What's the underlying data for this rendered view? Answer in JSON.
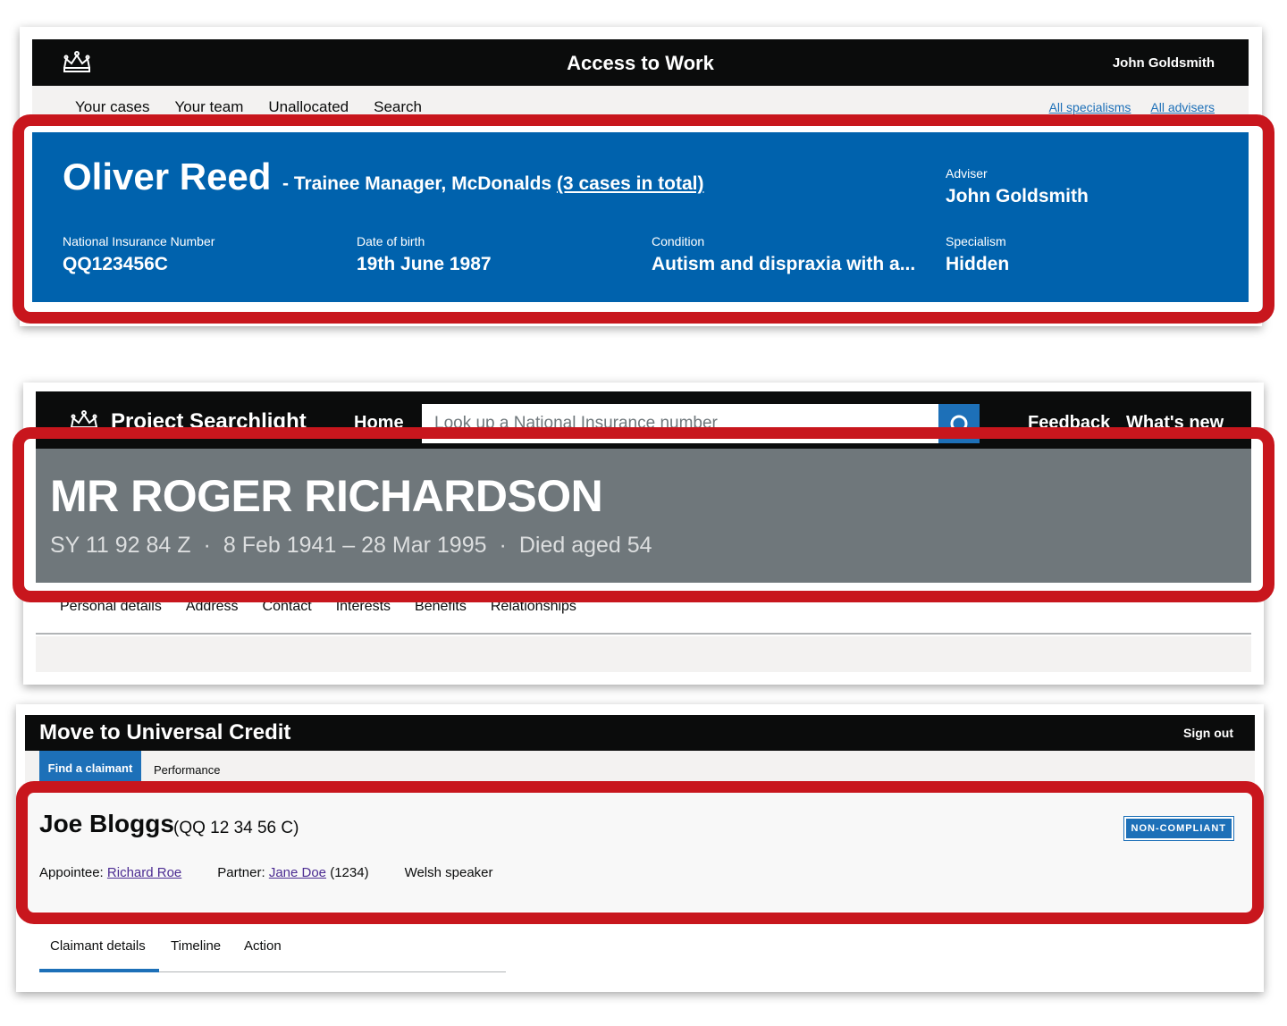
{
  "access_to_work": {
    "service_name": "Access to Work",
    "user_name": "John Goldsmith",
    "nav": [
      "Your cases",
      "Your team",
      "Unallocated",
      "Search"
    ],
    "filters": [
      "All specialisms",
      "All advisers"
    ],
    "person": {
      "name": "Oliver Reed",
      "role": "- Trainee Manager, McDonalds",
      "cases_link": "(3 cases in total)"
    },
    "fields": {
      "adviser_label": "Adviser",
      "adviser_value": "John Goldsmith",
      "ni_label": "National Insurance Number",
      "ni_value": "QQ123456C",
      "dob_label": "Date of birth",
      "dob_value": "19th June 1987",
      "condition_label": "Condition",
      "condition_value": "Autism and dispraxia with a...",
      "specialism_label": "Specialism",
      "specialism_value": "Hidden"
    },
    "colors": {
      "banner": "#0062ad",
      "header": "#0b0c0c"
    }
  },
  "project_searchlight": {
    "brand": "Project Searchlight",
    "home": "Home",
    "search_placeholder": "Look up a National Insurance number",
    "feedback": "Feedback",
    "whats_new": "What's new",
    "person": {
      "name": "MR ROGER RICHARDSON",
      "ni": "SY 11 92 84 Z",
      "dates": "8 Feb 1941 – 28 Mar 1995",
      "died": "Died aged 54",
      "separator": "·"
    },
    "tabs": [
      "Personal details",
      "Address",
      "Contact",
      "Interests",
      "Benefits",
      "Relationships"
    ],
    "colors": {
      "banner": "#6f777b",
      "search_button": "#1d70b8"
    }
  },
  "universal_credit": {
    "service_name": "Move to Universal Credit",
    "sign_out": "Sign out",
    "tabs": [
      "Find a claimant",
      "Performance"
    ],
    "claimant": {
      "name": "Joe Bloggs",
      "ni": "(QQ 12 34 56 C)",
      "status_badge": "NON-COMPLIANT",
      "appointee_label": "Appointee:",
      "appointee_link": "Richard Roe",
      "partner_label": "Partner:",
      "partner_link": "Jane Doe",
      "partner_id": "(1234)",
      "language": "Welsh speaker"
    },
    "subtabs": [
      "Claimant details",
      "Timeline",
      "Action"
    ],
    "colors": {
      "accent": "#1d70b8",
      "link_visited": "#4c2c92"
    }
  },
  "highlight_color": "#c8161d"
}
